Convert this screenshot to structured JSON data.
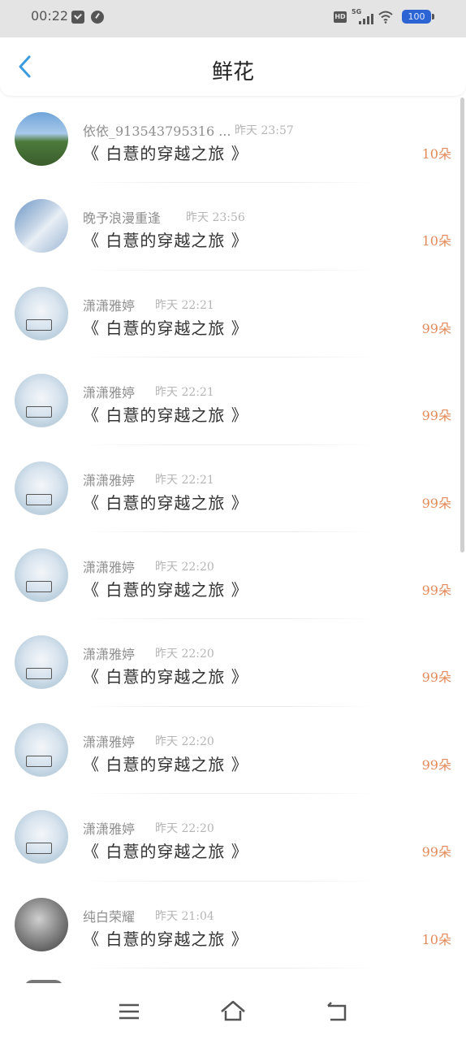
{
  "status_bar": {
    "time": "00:22",
    "hd_badge": "HD",
    "network": "5G",
    "battery": "100"
  },
  "header": {
    "title": "鲜花"
  },
  "colors": {
    "accent_blue": "#3b9be0",
    "count_orange": "#e38a5a"
  },
  "list": [
    {
      "name": "依依_913543795316 ...",
      "time": "昨天 23:57",
      "book": "《 白薏的穿越之旅 》",
      "count": "10朵",
      "avatar": "landscape-avatar"
    },
    {
      "name": "晚予浪漫重逢",
      "time": "昨天 23:56",
      "book": "《 白薏的穿越之旅 》",
      "count": "10朵",
      "avatar": "photo-avatar"
    },
    {
      "name": "潇潇雅婷",
      "time": "昨天 22:21",
      "book": "《 白薏的穿越之旅 》",
      "count": "99朵",
      "avatar": "anime-avatar"
    },
    {
      "name": "潇潇雅婷",
      "time": "昨天 22:21",
      "book": "《 白薏的穿越之旅 》",
      "count": "99朵",
      "avatar": "anime-avatar"
    },
    {
      "name": "潇潇雅婷",
      "time": "昨天 22:21",
      "book": "《 白薏的穿越之旅 》",
      "count": "99朵",
      "avatar": "anime-avatar"
    },
    {
      "name": "潇潇雅婷",
      "time": "昨天 22:20",
      "book": "《 白薏的穿越之旅 》",
      "count": "99朵",
      "avatar": "anime-avatar"
    },
    {
      "name": "潇潇雅婷",
      "time": "昨天 22:20",
      "book": "《 白薏的穿越之旅 》",
      "count": "99朵",
      "avatar": "anime-avatar"
    },
    {
      "name": "潇潇雅婷",
      "time": "昨天 22:20",
      "book": "《 白薏的穿越之旅 》",
      "count": "99朵",
      "avatar": "anime-avatar"
    },
    {
      "name": "潇潇雅婷",
      "time": "昨天 22:20",
      "book": "《 白薏的穿越之旅 》",
      "count": "99朵",
      "avatar": "anime-avatar"
    },
    {
      "name": "纯白荣耀",
      "time": "昨天 21:04",
      "book": "《 白薏的穿越之旅 》",
      "count": "10朵",
      "avatar": "bw-avatar"
    }
  ],
  "nav": {
    "menu_icon": "menu-icon",
    "home_icon": "home-icon",
    "back_icon": "back-nav-icon"
  }
}
